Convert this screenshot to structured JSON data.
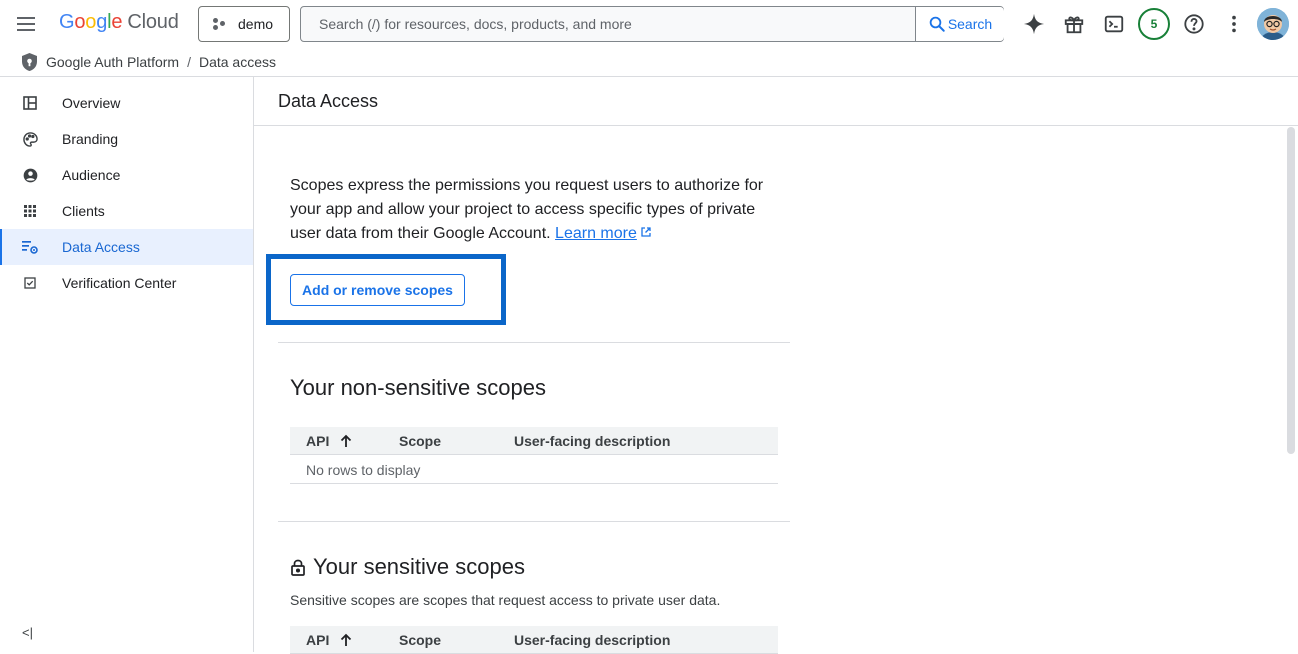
{
  "topbar": {
    "logo_letters": [
      "G",
      "o",
      "o",
      "g",
      "l",
      "e"
    ],
    "logo_suffix": "Cloud",
    "project": "demo",
    "search_placeholder": "Search (/) for resources, docs, products, and more",
    "search_button": "Search",
    "notification_count": "5",
    "icons": [
      "menu-icon",
      "gemini-icon",
      "gift-icon",
      "terminal-icon",
      "help-icon",
      "more-vert-icon"
    ]
  },
  "breadcrumb": {
    "product": "Google Auth Platform",
    "separator": "/",
    "page": "Data access"
  },
  "sidebar": {
    "items": [
      {
        "label": "Overview",
        "icon": "dashboard-icon"
      },
      {
        "label": "Branding",
        "icon": "palette-icon"
      },
      {
        "label": "Audience",
        "icon": "account-circle-icon"
      },
      {
        "label": "Clients",
        "icon": "apps-grid-icon"
      },
      {
        "label": "Data Access",
        "icon": "data-access-icon",
        "active": true
      },
      {
        "label": "Verification Center",
        "icon": "checkbox-icon"
      }
    ],
    "collapse_label": "<|"
  },
  "main": {
    "title": "Data Access",
    "intro_text": "Scopes express the permissions you request users to authorize for your app and allow your project to access specific types of private user data from their Google Account.",
    "learn_more": "Learn more",
    "scopes_button": "Add or remove scopes",
    "non_sensitive": {
      "heading": "Your non-sensitive scopes",
      "columns": [
        "API",
        "Scope",
        "User-facing description"
      ],
      "empty": "No rows to display"
    },
    "sensitive": {
      "heading": "Your sensitive scopes",
      "description": "Sensitive scopes are scopes that request access to private user data.",
      "columns": [
        "API",
        "Scope",
        "User-facing description"
      ]
    }
  },
  "colors": {
    "accent": "#1a73e8",
    "active_bg": "#e8f0fe",
    "focus_ring": "#0b66c9",
    "badge_green": "#188038"
  }
}
